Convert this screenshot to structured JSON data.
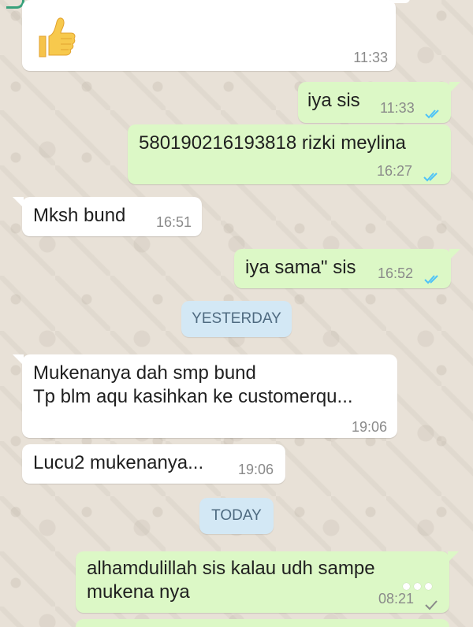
{
  "messages": [
    {
      "id": "m1",
      "direction": "in",
      "lines": [
        ""
      ],
      "emoji": "thumbs-up",
      "time": "11:33"
    },
    {
      "id": "m2",
      "direction": "out",
      "lines": [
        "iya sis"
      ],
      "time": "11:33",
      "status": "read"
    },
    {
      "id": "m3",
      "direction": "out",
      "lines": [
        "580190216193818 rizki meylina"
      ],
      "time": "16:27",
      "status": "read"
    },
    {
      "id": "m4",
      "direction": "in",
      "lines": [
        "Mksh bund"
      ],
      "time": "16:51"
    },
    {
      "id": "m5",
      "direction": "out",
      "lines": [
        "iya sama\" sis"
      ],
      "time": "16:52",
      "status": "read"
    },
    {
      "id": "m6",
      "direction": "in",
      "lines": [
        "Mukenanya dah smp bund",
        "Tp blm aqu kasihkan ke customerqu..."
      ],
      "time": "19:06"
    },
    {
      "id": "m7",
      "direction": "in",
      "lines": [
        "Lucu2 mukenanya..."
      ],
      "time": "19:06"
    },
    {
      "id": "m8",
      "direction": "out",
      "lines": [
        "alhamdulillah sis kalau udh sampe",
        "mukena nya"
      ],
      "time": "08:21",
      "status": "sent"
    }
  ],
  "date_chips": {
    "yesterday": "YESTERDAY",
    "today": "TODAY"
  },
  "colors": {
    "incoming_bubble": "#ffffff",
    "outgoing_bubble": "#dcf8c6",
    "read_ticks": "#4fc3f7",
    "sent_ticks": "#8a8a8a",
    "chat_background": "#e8e1d7",
    "date_chip_bg": "#d3e8f5",
    "date_chip_text": "#4e6a80"
  },
  "icons": {
    "thumbs_up": "thumbs-up-emoji",
    "more": "more-options-icon"
  }
}
